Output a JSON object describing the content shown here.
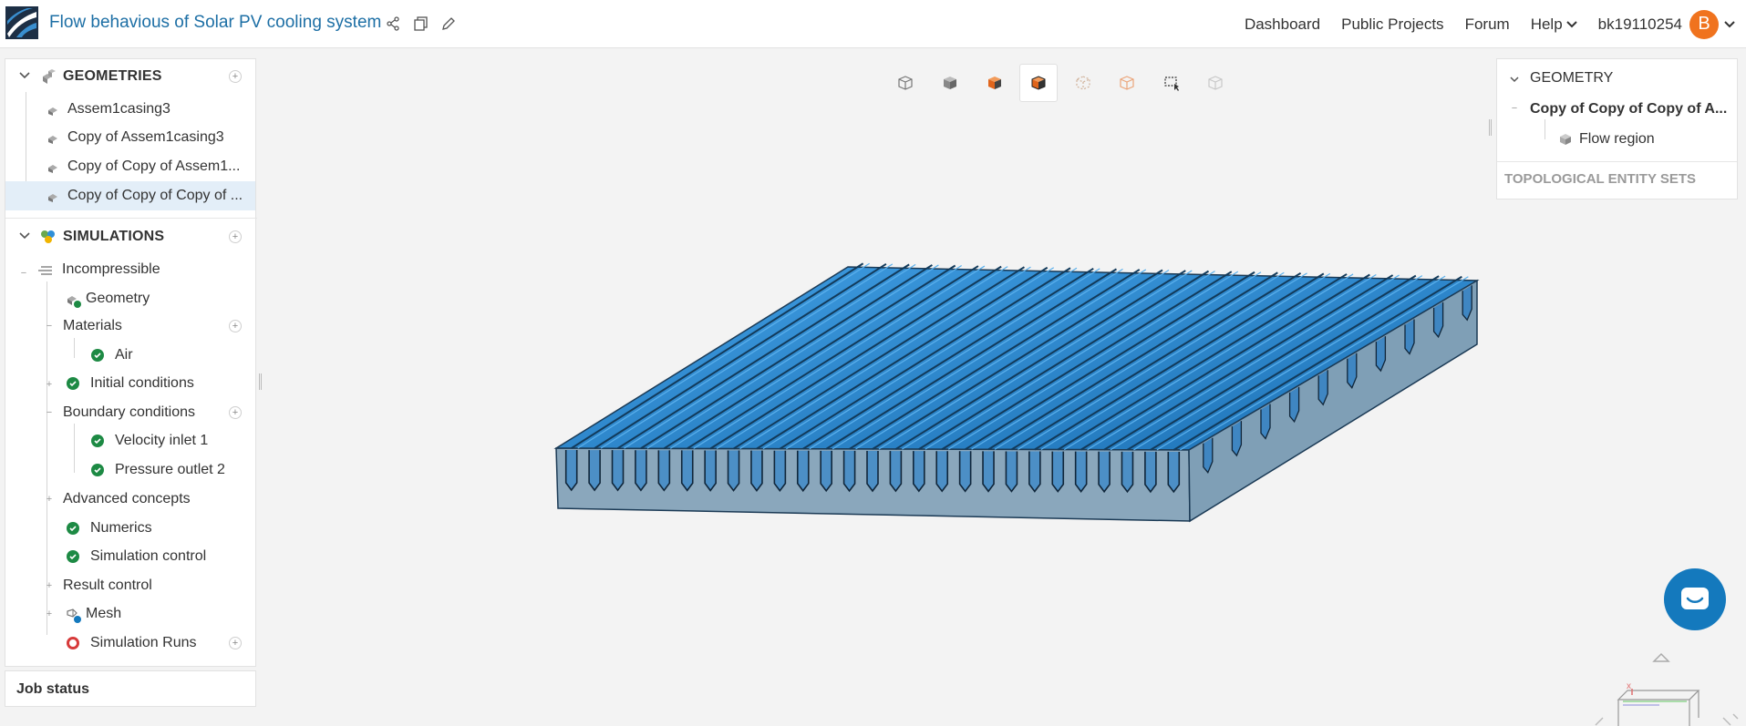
{
  "header": {
    "project_title": "Flow behavious of Solar PV cooling system",
    "nav": [
      "Dashboard",
      "Public Projects",
      "Forum"
    ],
    "help_label": "Help",
    "username": "bk19110254",
    "avatar_letter": "B",
    "icons": [
      "share-icon",
      "copy-icon",
      "edit-icon",
      "chevron-down-icon"
    ]
  },
  "tree": {
    "geometries_title": "GEOMETRIES",
    "geometries": [
      "Assem1casing3",
      "Copy of Assem1casing3",
      "Copy of Copy of Assem1...",
      "Copy of Copy of Copy of ..."
    ],
    "simulations_title": "SIMULATIONS",
    "simulation": "Incompressible",
    "geometry_label": "Geometry",
    "materials_label": "Materials",
    "material_air": "Air",
    "initial_conditions": "Initial conditions",
    "boundary_conditions": "Boundary conditions",
    "bc_items": [
      "Velocity inlet 1",
      "Pressure outlet 2"
    ],
    "advanced_concepts": "Advanced concepts",
    "numerics": "Numerics",
    "simulation_control": "Simulation control",
    "result_control": "Result control",
    "mesh": "Mesh",
    "simulation_runs": "Simulation Runs"
  },
  "job_status": "Job status",
  "viewport_toolbar": [
    "wireframe-cube-icon",
    "solid-cube-icon",
    "orange-cube-icon",
    "section-cube-icon",
    "points-cube-icon",
    "outline-cube-icon",
    "box-select-icon",
    "settings-cube-icon"
  ],
  "right_panel": {
    "title": "GEOMETRY",
    "item": "Copy of Copy of Copy of A...",
    "sub_item": "Flow region",
    "topological": "TOPOLOGICAL ENTITY SETS"
  },
  "colors": {
    "accent": "#1d6fa5",
    "model_blue": "#2f8fd8",
    "check_green": "#1d8a44",
    "avatar_orange": "#f0731e",
    "chat_blue": "#1479bd"
  }
}
